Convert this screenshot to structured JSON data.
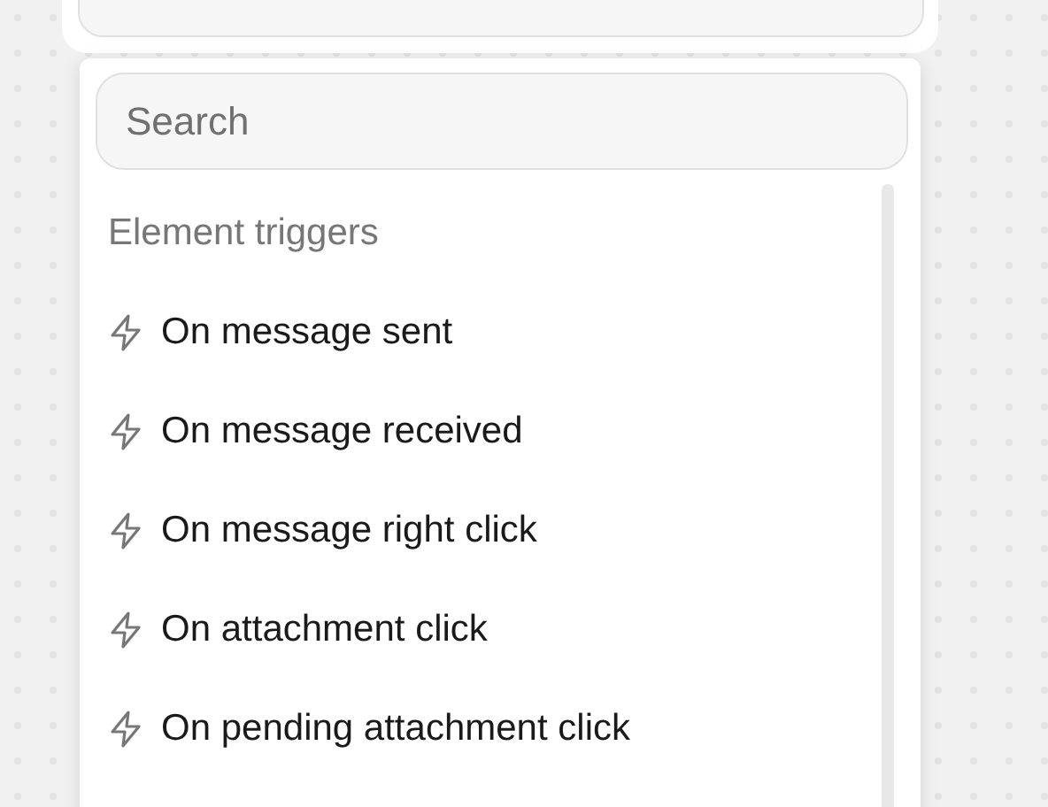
{
  "search": {
    "placeholder": "Search"
  },
  "section": {
    "heading": "Element triggers"
  },
  "items": [
    {
      "label": "On message sent"
    },
    {
      "label": "On message received"
    },
    {
      "label": "On message right click"
    },
    {
      "label": "On attachment click"
    },
    {
      "label": "On pending attachment click"
    }
  ]
}
